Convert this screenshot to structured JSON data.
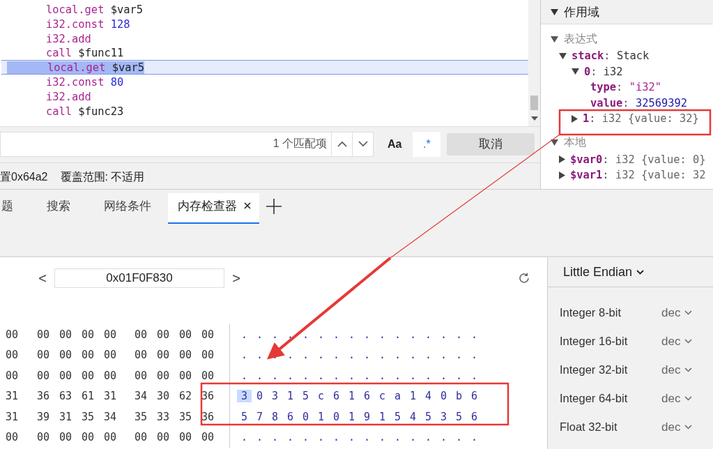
{
  "code": {
    "lines": [
      {
        "op": "local.get",
        "arg": "$var5",
        "kind": "name",
        "selected": false
      },
      {
        "op": "i32.const",
        "arg": "128",
        "kind": "number",
        "selected": false
      },
      {
        "op": "i32.add",
        "kind": "none",
        "selected": false
      },
      {
        "op": "call",
        "arg": "$func11",
        "kind": "name",
        "selected": false
      },
      {
        "op": "local.get",
        "arg": "$var5",
        "kind": "name",
        "selected": true
      },
      {
        "op": "i32.const",
        "arg": "80",
        "kind": "number",
        "selected": false
      },
      {
        "op": "i32.add",
        "kind": "none",
        "selected": false
      },
      {
        "op": "call",
        "arg": "$func23",
        "kind": "name",
        "selected": false
      }
    ]
  },
  "search": {
    "matches": "1 个匹配项",
    "case_label": "Aa",
    "regex_label": ".*",
    "regex_on": true,
    "cancel": "取消"
  },
  "status": {
    "position": "置0x64a2",
    "coverage": "覆盖范围: 不适用"
  },
  "scope": {
    "title": "作用域",
    "expanded": true,
    "sections": [
      {
        "label": "表达式",
        "expanded": true,
        "children": [
          {
            "key": "stack",
            "sep": ": ",
            "val": "Stack",
            "kind": "plain",
            "expanded": true,
            "children": [
              {
                "key": "0",
                "sep": ": ",
                "val": "i32",
                "kind": "plain",
                "expanded": true,
                "children": [
                  {
                    "key": "type",
                    "sep": ": ",
                    "val": "\"i32\"",
                    "kind": "string"
                  },
                  {
                    "key": "value",
                    "sep": ": ",
                    "val": "32569392",
                    "kind": "number"
                  }
                ]
              },
              {
                "key": "1",
                "sep": ": ",
                "val": "i32 {value: 32}",
                "kind": "object",
                "expanded": false
              }
            ]
          }
        ]
      },
      {
        "label": "本地",
        "expanded": true,
        "children": [
          {
            "key": "$var0",
            "sep": ": ",
            "val": "i32 {value: 0}",
            "kind": "object",
            "expanded": false
          },
          {
            "key": "$var1",
            "sep": ": ",
            "val": "i32 {value: 32",
            "kind": "object",
            "expanded": false
          }
        ]
      }
    ]
  },
  "tabs": [
    {
      "label": "题",
      "selected": false,
      "closable": false
    },
    {
      "label": "搜索",
      "selected": false,
      "closable": false
    },
    {
      "label": "网络条件",
      "selected": false,
      "closable": false
    },
    {
      "label": "内存检查器",
      "selected": true,
      "closable": true
    }
  ],
  "address": {
    "prev": "<",
    "value": "0x01F0F830",
    "next": ">"
  },
  "memory": {
    "rows": [
      {
        "first": "00",
        "bytes": [
          "00",
          "00",
          "00",
          "00",
          "00",
          "00",
          "00",
          "00"
        ],
        "ascii": "................",
        "cursor_at_start": false
      },
      {
        "first": "00",
        "bytes": [
          "00",
          "00",
          "00",
          "00",
          "00",
          "00",
          "00",
          "00"
        ],
        "ascii": "................",
        "cursor_at_start": false
      },
      {
        "first": "00",
        "bytes": [
          "00",
          "00",
          "00",
          "00",
          "00",
          "00",
          "00",
          "00"
        ],
        "ascii": "................",
        "cursor_at_start": false
      },
      {
        "first": "31",
        "bytes": [
          "36",
          "63",
          "61",
          "31",
          "34",
          "30",
          "62",
          "36"
        ],
        "ascii": "30315c616ca140b6",
        "cursor_at_start": true
      },
      {
        "first": "31",
        "bytes": [
          "39",
          "31",
          "35",
          "34",
          "35",
          "33",
          "35",
          "36"
        ],
        "ascii": "5786010191545356",
        "cursor_at_start": false
      },
      {
        "first": "00",
        "bytes": [
          "00",
          "00",
          "00",
          "00",
          "00",
          "00",
          "00",
          "00"
        ],
        "ascii": "................",
        "cursor_at_start": false
      }
    ]
  },
  "values": {
    "endian": "Little Endian",
    "rows": [
      {
        "label": "Integer 8-bit",
        "format": "dec"
      },
      {
        "label": "Integer 16-bit",
        "format": "dec"
      },
      {
        "label": "Integer 32-bit",
        "format": "dec"
      },
      {
        "label": "Integer 64-bit",
        "format": "dec"
      },
      {
        "label": "Float 32-bit",
        "format": "dec"
      }
    ]
  }
}
